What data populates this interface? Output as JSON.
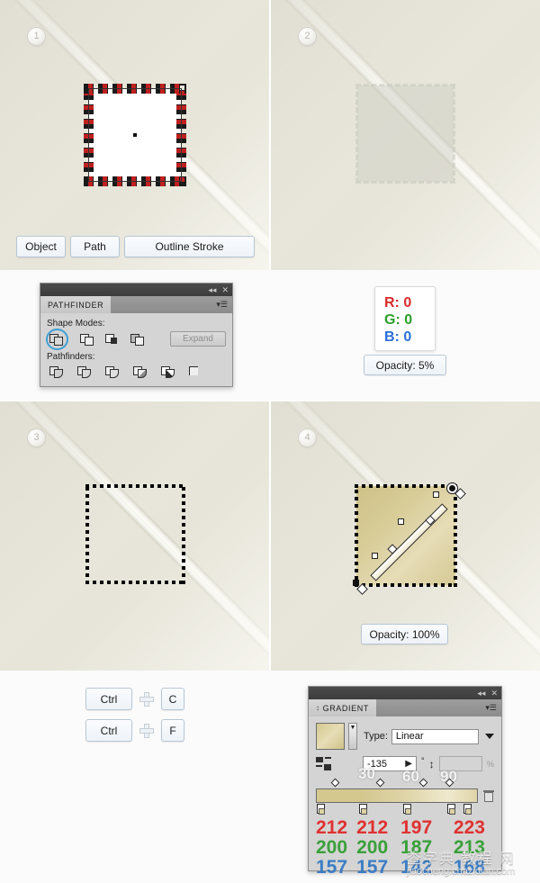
{
  "steps": [
    {
      "number": "1"
    },
    {
      "number": "2"
    },
    {
      "number": "3"
    },
    {
      "number": "4"
    }
  ],
  "step1": {
    "buttons": [
      {
        "label": "Object"
      },
      {
        "label": "Path"
      },
      {
        "label": "Outline Stroke"
      }
    ]
  },
  "pathfinder_panel": {
    "tab_title": "PATHFINDER",
    "collapse_icon": "◂◂",
    "close_icon": "✕",
    "menu_icon": "▾☰",
    "shape_modes_label": "Shape Modes:",
    "pathfinders_label": "Pathfinders:",
    "expand_label": "Expand",
    "shape_modes": [
      {
        "name": "unite",
        "selected": true
      },
      {
        "name": "minus-front",
        "selected": false
      },
      {
        "name": "intersect",
        "selected": false
      },
      {
        "name": "exclude",
        "selected": false
      }
    ],
    "pathfinders": [
      {
        "name": "divide"
      },
      {
        "name": "trim"
      },
      {
        "name": "merge"
      },
      {
        "name": "crop"
      },
      {
        "name": "outline"
      },
      {
        "name": "minus-back"
      }
    ]
  },
  "rgb_card": {
    "rows": [
      {
        "channel": "R:",
        "value": "0"
      },
      {
        "channel": "G:",
        "value": "0"
      },
      {
        "channel": "B:",
        "value": "0"
      }
    ],
    "colors": {
      "r": "#d82c2c",
      "g": "#2aa02a",
      "b": "#2a6fd8"
    }
  },
  "opacity_low": {
    "label": "Opacity: 5%"
  },
  "opacity_full": {
    "label": "Opacity: 100%"
  },
  "shortcuts": [
    {
      "key": "Ctrl",
      "plus": "+",
      "combo": "C"
    },
    {
      "key": "Ctrl",
      "plus": "+",
      "combo": "F"
    }
  ],
  "gradient_panel": {
    "tab_title": "GRADIENT",
    "grip_icon": "↕",
    "collapse_icon": "◂◂",
    "close_icon": "✕",
    "menu_icon": "▾☰",
    "type_label": "Type:",
    "type_value": "Linear",
    "angle_value": "-135",
    "degree_symbol": "°",
    "aspect_value": "",
    "percent_symbol": "%",
    "reverse_icon": "reverse-gradient-icon",
    "delete_stop_icon": "trash-icon",
    "stops_rgb": [
      {
        "r": "212",
        "g": "200",
        "b": "157"
      },
      {
        "r": "212",
        "g": "200",
        "b": "157"
      },
      {
        "r": "197",
        "g": "187",
        "b": "142"
      },
      {
        "r": "223",
        "g": "213",
        "b": "168"
      }
    ],
    "ghost_numbers": [
      "30",
      "60",
      "90"
    ],
    "swatch_color": "#d4c88f"
  },
  "watermark": {
    "cn": "查字典 教程 网",
    "url": "jiaocheng.chazidian.com"
  }
}
